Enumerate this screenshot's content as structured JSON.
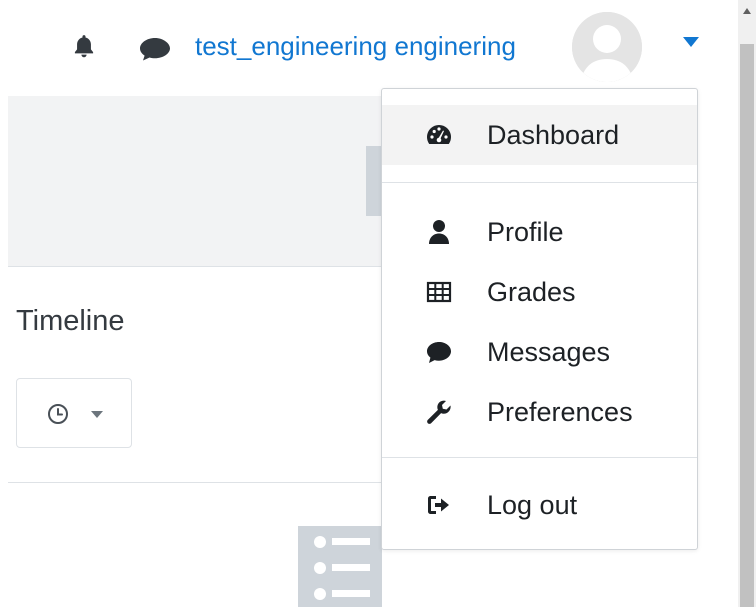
{
  "navbar": {
    "username": "test_engineering enginering",
    "bell_icon": "bell-icon",
    "messages_icon": "chat-icon",
    "user_menu_toggle_icon": "caret-down-icon"
  },
  "page": {
    "timeline_title": "Timeline",
    "timeline_filter_icon": "clock-icon",
    "empty_state_icon": "list-icon"
  },
  "user_menu": {
    "items": [
      {
        "label": "Dashboard",
        "icon": "tachometer-icon"
      },
      {
        "label": "Profile",
        "icon": "user-icon"
      },
      {
        "label": "Grades",
        "icon": "table-icon"
      },
      {
        "label": "Messages",
        "icon": "comment-icon"
      },
      {
        "label": "Preferences",
        "icon": "wrench-icon"
      },
      {
        "label": "Log out",
        "icon": "sign-out-icon"
      }
    ]
  },
  "colors": {
    "link": "#1177d1",
    "text": "#1d2125",
    "icon": "#343a40",
    "highlight": "#f3f3f3"
  }
}
